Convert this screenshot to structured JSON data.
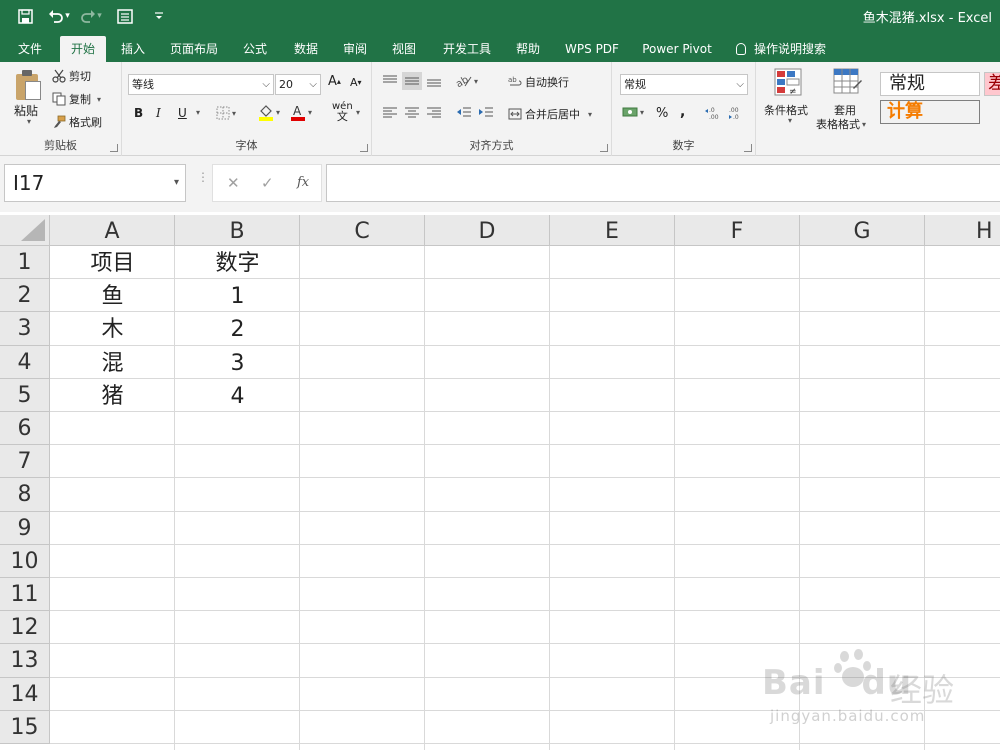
{
  "app": {
    "window_title": "鱼木混猪.xlsx  -  Excel"
  },
  "tabs": [
    {
      "label": "文件"
    },
    {
      "label": "开始"
    },
    {
      "label": "插入"
    },
    {
      "label": "页面布局"
    },
    {
      "label": "公式"
    },
    {
      "label": "数据"
    },
    {
      "label": "审阅"
    },
    {
      "label": "视图"
    },
    {
      "label": "开发工具"
    },
    {
      "label": "帮助"
    },
    {
      "label": "WPS PDF"
    },
    {
      "label": "Power Pivot"
    },
    {
      "label": "操作说明搜索"
    }
  ],
  "ribbon": {
    "clipboard": {
      "paste": "粘贴",
      "cut": "剪切",
      "copy": "复制",
      "format_painter": "格式刷",
      "label": "剪贴板"
    },
    "font": {
      "font_name": "等线",
      "font_size": "20",
      "grow": "A",
      "shrink": "A",
      "bold": "B",
      "italic": "I",
      "underline": "U",
      "phonetic": "wén",
      "label": "字体"
    },
    "alignment": {
      "wrap_text": "自动换行",
      "merge_center": "合并后居中",
      "label": "对齐方式"
    },
    "number": {
      "format": "常规",
      "percent": "%",
      "comma": ",",
      "label": "数字"
    },
    "styles": {
      "conditional": "条件格式",
      "table_format_line1": "套用",
      "table_format_line2": "表格格式",
      "style_normal": "常规",
      "style_calc": "计算",
      "style_partial": "差"
    }
  },
  "formula_bar": {
    "name_box": "I17",
    "fx": "fx",
    "formula": ""
  },
  "sheet": {
    "columns": [
      "A",
      "B",
      "C",
      "D",
      "E",
      "F",
      "G",
      "H"
    ],
    "rows": [
      "1",
      "2",
      "3",
      "4",
      "5",
      "6",
      "7",
      "8",
      "9",
      "10",
      "11",
      "12",
      "13",
      "14",
      "15"
    ],
    "cells": {
      "A1": "项目",
      "B1": "数字",
      "A2": "鱼",
      "B2": "1",
      "A3": "木",
      "B3": "2",
      "A4": "混",
      "B4": "3",
      "A5": "猪",
      "B5": "4"
    }
  },
  "watermark": {
    "brand": "Bai",
    "brand2": "du",
    "cn": "经验",
    "url": "jingyan.baidu.com"
  },
  "colors": {
    "accent": "#217346",
    "ribbon_bg": "#f3f3f3",
    "header_bg": "#e9e9e9",
    "gridline": "#d9d9d9"
  }
}
